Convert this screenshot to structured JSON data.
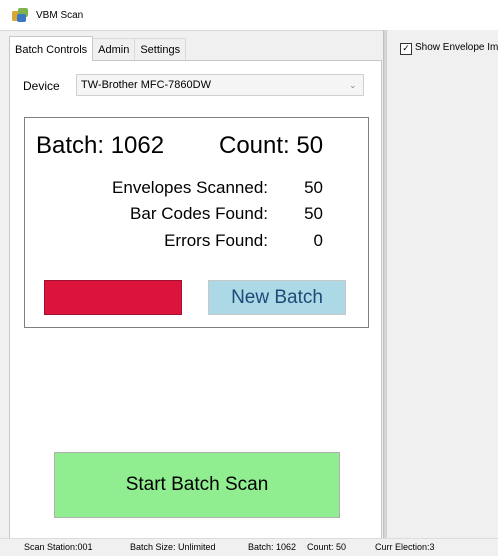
{
  "window": {
    "title": "VBM Scan"
  },
  "tabs": [
    {
      "label": "Batch Controls"
    },
    {
      "label": "Admin"
    },
    {
      "label": "Settings"
    }
  ],
  "device": {
    "label": "Device",
    "selected": "TW-Brother MFC-7860DW"
  },
  "batch": {
    "batch_text": "Batch: 1062",
    "count_text": "Count: 50",
    "stats": [
      {
        "label": "Envelopes Scanned:",
        "value": "50"
      },
      {
        "label": "Bar Codes Found:",
        "value": "50"
      },
      {
        "label": "Errors Found:",
        "value": "0"
      }
    ],
    "new_batch_label": "New Batch"
  },
  "start_button": {
    "label": "Start Batch Scan"
  },
  "right_pane": {
    "show_envelope_label": "Show Envelope Im",
    "checked": true,
    "check_mark": "✓"
  },
  "status_bar": {
    "station": "Scan Station:001",
    "batch_size": "Batch Size: Unlimited",
    "batch": "Batch: 1062",
    "count": "Count: 50",
    "election": "Curr Election:3"
  },
  "colors": {
    "red_button": "#dc143c",
    "new_batch_button": "#add8e6",
    "start_button": "#90ee90"
  }
}
